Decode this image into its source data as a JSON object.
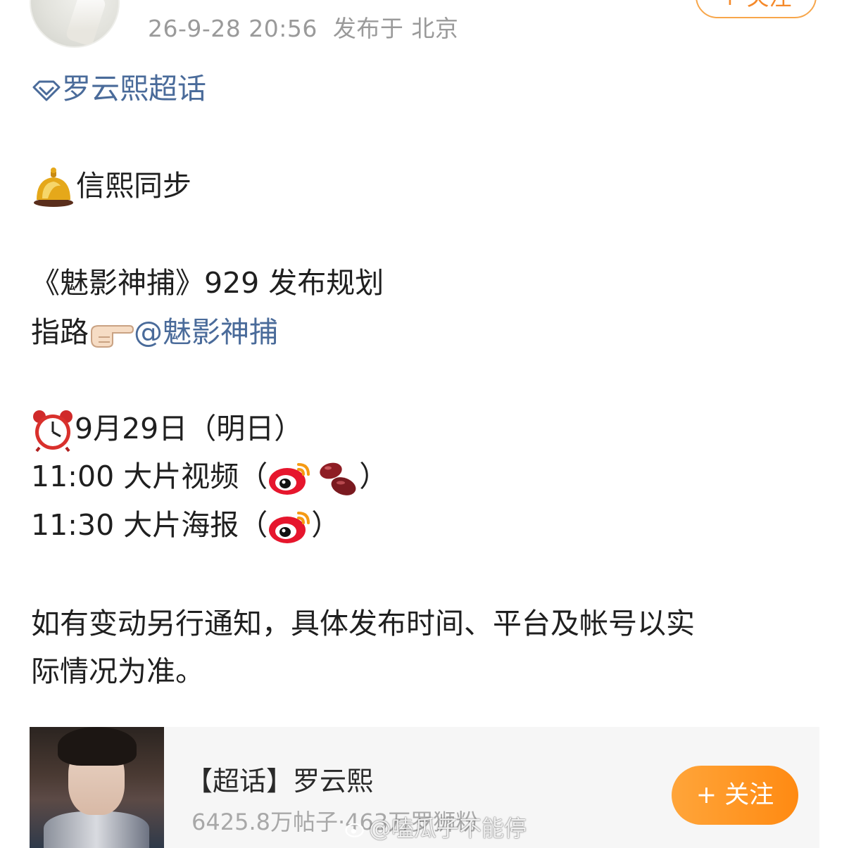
{
  "post": {
    "timestamp": "26-9-28 20:56",
    "location": "发布于 北京",
    "follow_label": "+ 关注"
  },
  "content": {
    "supertopic_link": "罗云熙超话",
    "line_sync": "信熙同步",
    "line_plan": "《魅影神捕》929 发布规划",
    "line_route_prefix": "指路",
    "line_route_mention": "@魅影神捕",
    "line_date": "9月29日（明日）",
    "line_video": "11:00 大片视频（",
    "line_video_close": "）",
    "line_poster": "11:30 大片海报（",
    "line_poster_close": "）",
    "notice_line1": "如有变动另行通知，具体发布时间、平台及帐号以实",
    "notice_line2": "际情况为准。"
  },
  "icons": {
    "supertopic": "diamond-icon",
    "bell": "bell-emoji-icon",
    "pointing": "pointing-right-emoji-icon",
    "clock": "alarm-clock-emoji-icon",
    "weibo": "weibo-logo-icon",
    "bean": "red-bean-emoji-icon"
  },
  "card": {
    "title": "【超话】罗云熙",
    "stats": "6425.8万帖子·463万罗狮粉",
    "follow_label": "+ 关注"
  },
  "watermark": "@嗑瓜子不能停",
  "colors": {
    "link": "#4a6b9a",
    "accent": "#ff8a12",
    "meta": "#9a9a9a"
  }
}
